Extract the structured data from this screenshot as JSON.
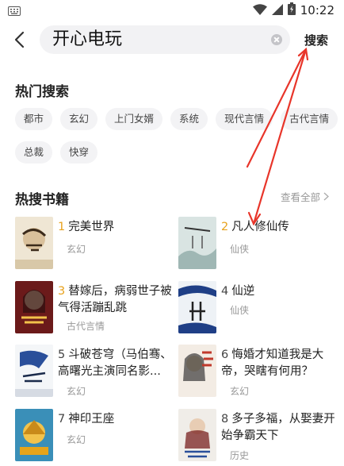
{
  "status_bar": {
    "time": "10:22"
  },
  "search": {
    "query": "开心电玩",
    "submit_label": "搜索"
  },
  "hot_search": {
    "title": "热门搜索",
    "tags_row1": [
      "都市",
      "玄幻",
      "上门女婿",
      "系统",
      "现代言情",
      "古代言情"
    ],
    "tags_row2": [
      "总裁",
      "快穿"
    ]
  },
  "hot_books": {
    "title": "热搜书籍",
    "view_all": "查看全部",
    "items": [
      {
        "rank": "1",
        "title": "完美世界",
        "genre": "玄幻"
      },
      {
        "rank": "2",
        "title": "凡人修仙传",
        "genre": "仙侠"
      },
      {
        "rank": "3",
        "title": "替嫁后，病弱世子被气得活蹦乱跳",
        "genre": "古代言情"
      },
      {
        "rank": "4",
        "title": "仙逆",
        "genre": "仙侠"
      },
      {
        "rank": "5",
        "title": "斗破苍穹（马伯骞、高曙光主演同名影...",
        "genre": "玄幻"
      },
      {
        "rank": "6",
        "title": "悔婚才知道我是大帝，哭瞎有何用？",
        "genre": "玄幻"
      },
      {
        "rank": "7",
        "title": "神印王座",
        "genre": "玄幻"
      },
      {
        "rank": "8",
        "title": "多子多福，从娶妻开始争霸天下",
        "genre": "历史"
      }
    ]
  },
  "colors": {
    "rank_highlight": "#e8a21d",
    "annotation_arrow": "#e8352a"
  },
  "icons": [
    "keyboard-icon",
    "wifi-icon",
    "signal-icon",
    "battery-icon",
    "back-arrow-icon",
    "clear-icon",
    "chevron-right-icon"
  ]
}
